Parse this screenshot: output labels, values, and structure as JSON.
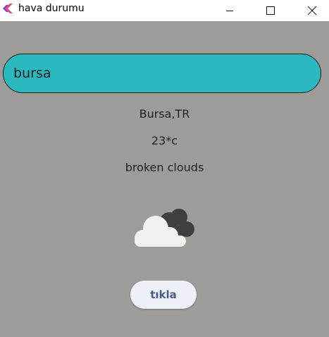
{
  "window": {
    "title": "hava durumu"
  },
  "search": {
    "value": "bursa"
  },
  "weather": {
    "location": "Bursa,TR",
    "temperature": "23*c",
    "description": "broken clouds",
    "icon": "broken-clouds-icon"
  },
  "action_button": {
    "label": "tıkla"
  },
  "colors": {
    "background": "#9e9c98",
    "search_fill": "#29b9bf",
    "button_text": "#465e86"
  }
}
